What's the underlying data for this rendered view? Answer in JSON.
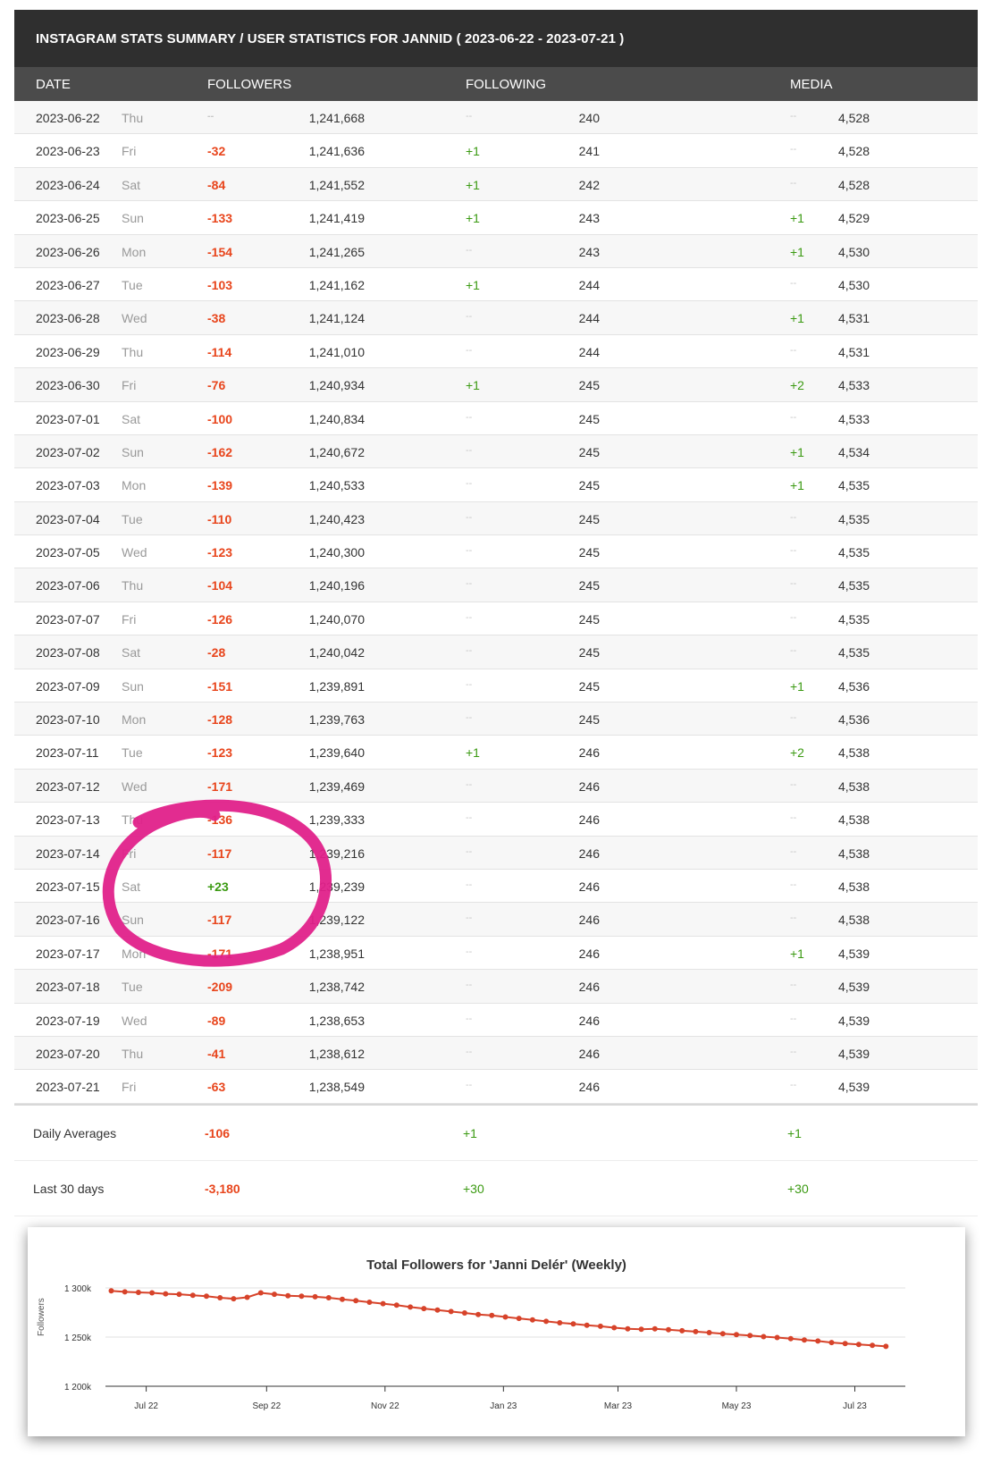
{
  "title": "INSTAGRAM STATS SUMMARY / USER STATISTICS FOR JANNID ( 2023-06-22 - 2023-07-21 )",
  "headers": {
    "date": "DATE",
    "followers": "FOLLOWERS",
    "following": "FOLLOWING",
    "media": "MEDIA"
  },
  "colors": {
    "negative": "#e8451c",
    "positive": "#3b9a12",
    "header_bg": "#2f2f2f",
    "annotation": "#e0218a",
    "line": "#d7432a"
  },
  "rows": [
    {
      "date": "2023-06-22",
      "day": "Thu",
      "f_delta": "--",
      "followers": "1,241,668",
      "g_delta": "--",
      "following": "240",
      "m_delta": "--",
      "media": "4,528"
    },
    {
      "date": "2023-06-23",
      "day": "Fri",
      "f_delta": "-32",
      "followers": "1,241,636",
      "g_delta": "+1",
      "following": "241",
      "m_delta": "--",
      "media": "4,528"
    },
    {
      "date": "2023-06-24",
      "day": "Sat",
      "f_delta": "-84",
      "followers": "1,241,552",
      "g_delta": "+1",
      "following": "242",
      "m_delta": "--",
      "media": "4,528"
    },
    {
      "date": "2023-06-25",
      "day": "Sun",
      "f_delta": "-133",
      "followers": "1,241,419",
      "g_delta": "+1",
      "following": "243",
      "m_delta": "+1",
      "media": "4,529"
    },
    {
      "date": "2023-06-26",
      "day": "Mon",
      "f_delta": "-154",
      "followers": "1,241,265",
      "g_delta": "--",
      "following": "243",
      "m_delta": "+1",
      "media": "4,530"
    },
    {
      "date": "2023-06-27",
      "day": "Tue",
      "f_delta": "-103",
      "followers": "1,241,162",
      "g_delta": "+1",
      "following": "244",
      "m_delta": "--",
      "media": "4,530"
    },
    {
      "date": "2023-06-28",
      "day": "Wed",
      "f_delta": "-38",
      "followers": "1,241,124",
      "g_delta": "--",
      "following": "244",
      "m_delta": "+1",
      "media": "4,531"
    },
    {
      "date": "2023-06-29",
      "day": "Thu",
      "f_delta": "-114",
      "followers": "1,241,010",
      "g_delta": "--",
      "following": "244",
      "m_delta": "--",
      "media": "4,531"
    },
    {
      "date": "2023-06-30",
      "day": "Fri",
      "f_delta": "-76",
      "followers": "1,240,934",
      "g_delta": "+1",
      "following": "245",
      "m_delta": "+2",
      "media": "4,533"
    },
    {
      "date": "2023-07-01",
      "day": "Sat",
      "f_delta": "-100",
      "followers": "1,240,834",
      "g_delta": "--",
      "following": "245",
      "m_delta": "--",
      "media": "4,533"
    },
    {
      "date": "2023-07-02",
      "day": "Sun",
      "f_delta": "-162",
      "followers": "1,240,672",
      "g_delta": "--",
      "following": "245",
      "m_delta": "+1",
      "media": "4,534"
    },
    {
      "date": "2023-07-03",
      "day": "Mon",
      "f_delta": "-139",
      "followers": "1,240,533",
      "g_delta": "--",
      "following": "245",
      "m_delta": "+1",
      "media": "4,535"
    },
    {
      "date": "2023-07-04",
      "day": "Tue",
      "f_delta": "-110",
      "followers": "1,240,423",
      "g_delta": "--",
      "following": "245",
      "m_delta": "--",
      "media": "4,535"
    },
    {
      "date": "2023-07-05",
      "day": "Wed",
      "f_delta": "-123",
      "followers": "1,240,300",
      "g_delta": "--",
      "following": "245",
      "m_delta": "--",
      "media": "4,535"
    },
    {
      "date": "2023-07-06",
      "day": "Thu",
      "f_delta": "-104",
      "followers": "1,240,196",
      "g_delta": "--",
      "following": "245",
      "m_delta": "--",
      "media": "4,535"
    },
    {
      "date": "2023-07-07",
      "day": "Fri",
      "f_delta": "-126",
      "followers": "1,240,070",
      "g_delta": "--",
      "following": "245",
      "m_delta": "--",
      "media": "4,535"
    },
    {
      "date": "2023-07-08",
      "day": "Sat",
      "f_delta": "-28",
      "followers": "1,240,042",
      "g_delta": "--",
      "following": "245",
      "m_delta": "--",
      "media": "4,535"
    },
    {
      "date": "2023-07-09",
      "day": "Sun",
      "f_delta": "-151",
      "followers": "1,239,891",
      "g_delta": "--",
      "following": "245",
      "m_delta": "+1",
      "media": "4,536"
    },
    {
      "date": "2023-07-10",
      "day": "Mon",
      "f_delta": "-128",
      "followers": "1,239,763",
      "g_delta": "--",
      "following": "245",
      "m_delta": "--",
      "media": "4,536"
    },
    {
      "date": "2023-07-11",
      "day": "Tue",
      "f_delta": "-123",
      "followers": "1,239,640",
      "g_delta": "+1",
      "following": "246",
      "m_delta": "+2",
      "media": "4,538"
    },
    {
      "date": "2023-07-12",
      "day": "Wed",
      "f_delta": "-171",
      "followers": "1,239,469",
      "g_delta": "--",
      "following": "246",
      "m_delta": "--",
      "media": "4,538"
    },
    {
      "date": "2023-07-13",
      "day": "Thu",
      "f_delta": "-136",
      "followers": "1,239,333",
      "g_delta": "--",
      "following": "246",
      "m_delta": "--",
      "media": "4,538"
    },
    {
      "date": "2023-07-14",
      "day": "Fri",
      "f_delta": "-117",
      "followers": "1,239,216",
      "g_delta": "--",
      "following": "246",
      "m_delta": "--",
      "media": "4,538"
    },
    {
      "date": "2023-07-15",
      "day": "Sat",
      "f_delta": "+23",
      "followers": "1,239,239",
      "g_delta": "--",
      "following": "246",
      "m_delta": "--",
      "media": "4,538"
    },
    {
      "date": "2023-07-16",
      "day": "Sun",
      "f_delta": "-117",
      "followers": "1,239,122",
      "g_delta": "--",
      "following": "246",
      "m_delta": "--",
      "media": "4,538"
    },
    {
      "date": "2023-07-17",
      "day": "Mon",
      "f_delta": "-171",
      "followers": "1,238,951",
      "g_delta": "--",
      "following": "246",
      "m_delta": "+1",
      "media": "4,539"
    },
    {
      "date": "2023-07-18",
      "day": "Tue",
      "f_delta": "-209",
      "followers": "1,238,742",
      "g_delta": "--",
      "following": "246",
      "m_delta": "--",
      "media": "4,539"
    },
    {
      "date": "2023-07-19",
      "day": "Wed",
      "f_delta": "-89",
      "followers": "1,238,653",
      "g_delta": "--",
      "following": "246",
      "m_delta": "--",
      "media": "4,539"
    },
    {
      "date": "2023-07-20",
      "day": "Thu",
      "f_delta": "-41",
      "followers": "1,238,612",
      "g_delta": "--",
      "following": "246",
      "m_delta": "--",
      "media": "4,539"
    },
    {
      "date": "2023-07-21",
      "day": "Fri",
      "f_delta": "-63",
      "followers": "1,238,549",
      "g_delta": "--",
      "following": "246",
      "m_delta": "--",
      "media": "4,539"
    }
  ],
  "summary": [
    {
      "label": "Daily Averages",
      "followers": "-106",
      "following": "+1",
      "media": "+1"
    },
    {
      "label": "Last 30 days",
      "followers": "-3,180",
      "following": "+30",
      "media": "+30"
    }
  ],
  "annotation": {
    "shape": "hand-drawn circle",
    "target_rows": [
      "2023-07-13",
      "2023-07-14",
      "2023-07-15",
      "2023-07-16",
      "2023-07-17"
    ]
  },
  "chart_data": {
    "type": "line",
    "title": "Total Followers for 'Janni Delér' (Weekly)",
    "ylabel": "Followers",
    "ylim": [
      1200000,
      1300000
    ],
    "yticks": [
      {
        "v": 1300000,
        "label": "1 300k"
      },
      {
        "v": 1250000,
        "label": "1 250k"
      },
      {
        "v": 1200000,
        "label": "1 200k"
      }
    ],
    "xlim": [
      "2022-06-10",
      "2023-07-27"
    ],
    "xticks": [
      {
        "date": "2022-07-01",
        "label": "Jul 22"
      },
      {
        "date": "2022-09-01",
        "label": "Sep 22"
      },
      {
        "date": "2022-11-01",
        "label": "Nov 22"
      },
      {
        "date": "2023-01-01",
        "label": "Jan 23"
      },
      {
        "date": "2023-03-01",
        "label": "Mar 23"
      },
      {
        "date": "2023-05-01",
        "label": "May 23"
      },
      {
        "date": "2023-07-01",
        "label": "Jul 23"
      }
    ],
    "grid": true,
    "series": [
      {
        "color": "#d7432a",
        "points": [
          {
            "x": "2022-06-13",
            "y": 1297000
          },
          {
            "x": "2022-06-20",
            "y": 1296000
          },
          {
            "x": "2022-06-27",
            "y": 1295500
          },
          {
            "x": "2022-07-04",
            "y": 1295000
          },
          {
            "x": "2022-07-11",
            "y": 1294000
          },
          {
            "x": "2022-07-18",
            "y": 1293500
          },
          {
            "x": "2022-07-25",
            "y": 1292500
          },
          {
            "x": "2022-08-01",
            "y": 1291500
          },
          {
            "x": "2022-08-08",
            "y": 1290000
          },
          {
            "x": "2022-08-15",
            "y": 1289000
          },
          {
            "x": "2022-08-22",
            "y": 1290500
          },
          {
            "x": "2022-08-29",
            "y": 1295000
          },
          {
            "x": "2022-09-05",
            "y": 1293500
          },
          {
            "x": "2022-09-12",
            "y": 1292000
          },
          {
            "x": "2022-09-19",
            "y": 1291500
          },
          {
            "x": "2022-09-26",
            "y": 1291000
          },
          {
            "x": "2022-10-03",
            "y": 1290000
          },
          {
            "x": "2022-10-10",
            "y": 1288500
          },
          {
            "x": "2022-10-17",
            "y": 1287000
          },
          {
            "x": "2022-10-24",
            "y": 1285500
          },
          {
            "x": "2022-10-31",
            "y": 1284000
          },
          {
            "x": "2022-11-07",
            "y": 1282500
          },
          {
            "x": "2022-11-14",
            "y": 1280500
          },
          {
            "x": "2022-11-21",
            "y": 1279000
          },
          {
            "x": "2022-11-28",
            "y": 1277500
          },
          {
            "x": "2022-12-05",
            "y": 1276000
          },
          {
            "x": "2022-12-12",
            "y": 1274500
          },
          {
            "x": "2022-12-19",
            "y": 1273000
          },
          {
            "x": "2022-12-26",
            "y": 1272000
          },
          {
            "x": "2023-01-02",
            "y": 1270500
          },
          {
            "x": "2023-01-09",
            "y": 1269000
          },
          {
            "x": "2023-01-16",
            "y": 1267500
          },
          {
            "x": "2023-01-23",
            "y": 1266000
          },
          {
            "x": "2023-01-30",
            "y": 1264500
          },
          {
            "x": "2023-02-06",
            "y": 1263500
          },
          {
            "x": "2023-02-13",
            "y": 1262000
          },
          {
            "x": "2023-02-20",
            "y": 1261000
          },
          {
            "x": "2023-02-27",
            "y": 1259500
          },
          {
            "x": "2023-03-06",
            "y": 1258500
          },
          {
            "x": "2023-03-13",
            "y": 1258000
          },
          {
            "x": "2023-03-20",
            "y": 1258500
          },
          {
            "x": "2023-03-27",
            "y": 1257500
          },
          {
            "x": "2023-04-03",
            "y": 1256500
          },
          {
            "x": "2023-04-10",
            "y": 1255500
          },
          {
            "x": "2023-04-17",
            "y": 1254500
          },
          {
            "x": "2023-04-24",
            "y": 1253500
          },
          {
            "x": "2023-05-01",
            "y": 1252500
          },
          {
            "x": "2023-05-08",
            "y": 1251500
          },
          {
            "x": "2023-05-15",
            "y": 1250500
          },
          {
            "x": "2023-05-22",
            "y": 1249500
          },
          {
            "x": "2023-05-29",
            "y": 1248500
          },
          {
            "x": "2023-06-05",
            "y": 1247000
          },
          {
            "x": "2023-06-12",
            "y": 1246000
          },
          {
            "x": "2023-06-19",
            "y": 1244500
          },
          {
            "x": "2023-06-26",
            "y": 1243500
          },
          {
            "x": "2023-07-03",
            "y": 1242500
          },
          {
            "x": "2023-07-10",
            "y": 1241500
          },
          {
            "x": "2023-07-17",
            "y": 1240500
          }
        ]
      }
    ]
  }
}
